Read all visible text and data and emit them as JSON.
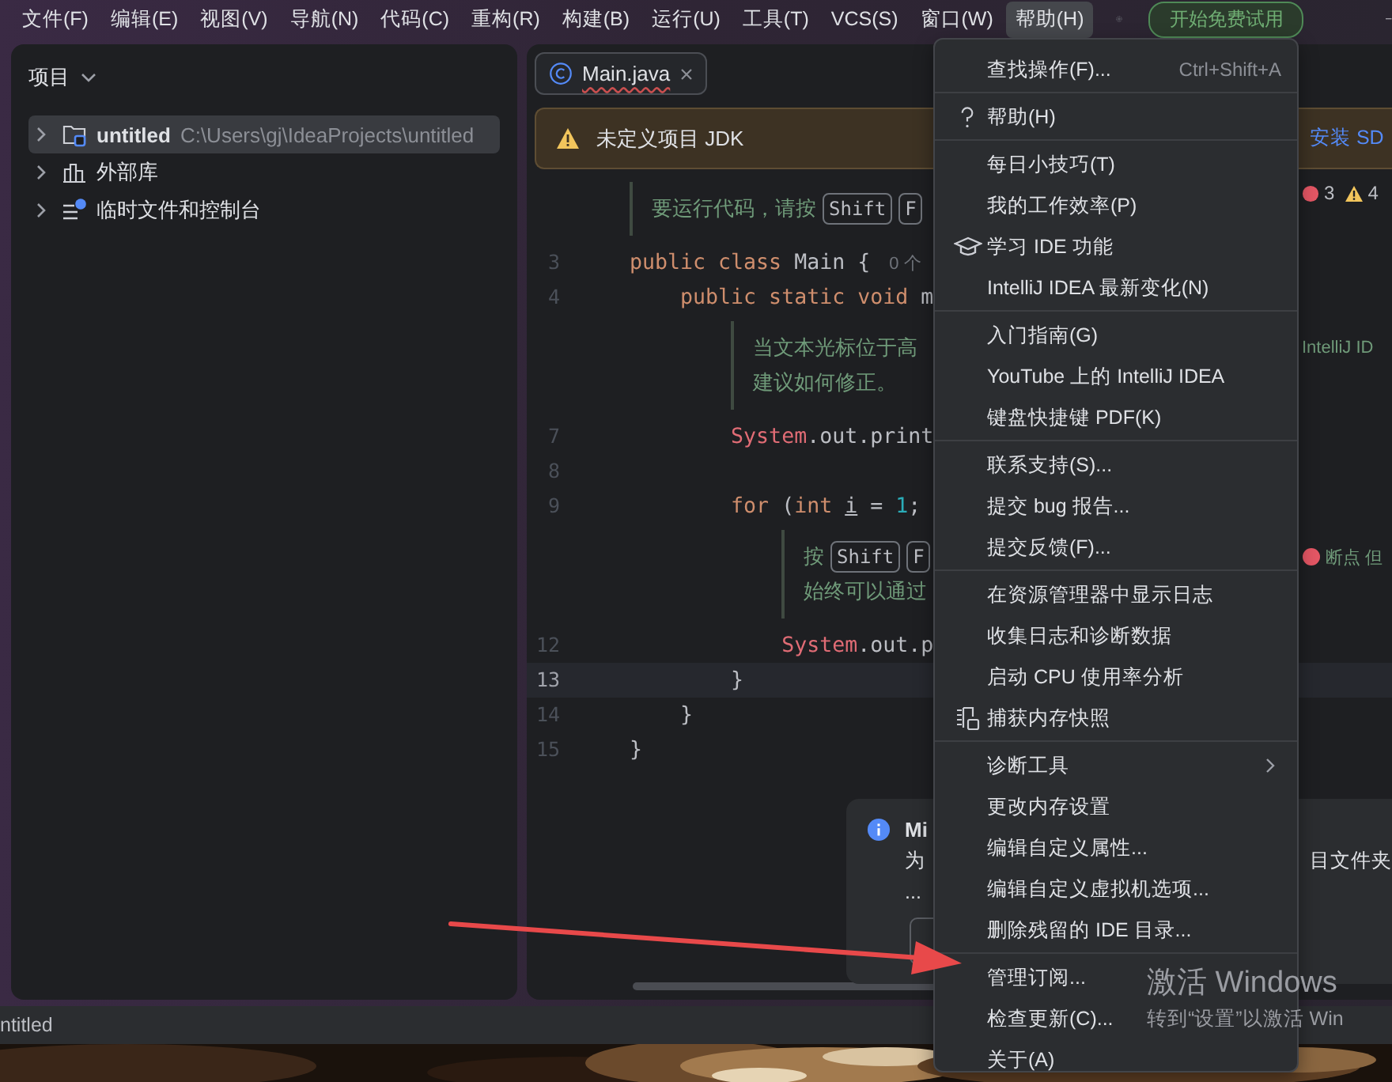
{
  "menu_bar": {
    "items": [
      {
        "label": "文件(F)",
        "selected": false
      },
      {
        "label": "编辑(E)",
        "selected": false
      },
      {
        "label": "视图(V)",
        "selected": false
      },
      {
        "label": "导航(N)",
        "selected": false
      },
      {
        "label": "代码(C)",
        "selected": false
      },
      {
        "label": "重构(R)",
        "selected": false
      },
      {
        "label": "构建(B)",
        "selected": false
      },
      {
        "label": "运行(U)",
        "selected": false
      },
      {
        "label": "工具(T)",
        "selected": false
      },
      {
        "label": "VCS(S)",
        "selected": false
      },
      {
        "label": "窗口(W)",
        "selected": false
      },
      {
        "label": "帮助(H)",
        "selected": true
      }
    ],
    "trial_button": "开始免费试用"
  },
  "project_panel": {
    "title": "项目",
    "tree": [
      {
        "kind": "module",
        "label": "untitled",
        "path": "C:\\Users\\gj\\IdeaProjects\\untitled",
        "selected": true,
        "expanded": false
      },
      {
        "kind": "library",
        "label": "外部库",
        "selected": false,
        "expanded": false
      },
      {
        "kind": "scratch",
        "label": "临时文件和控制台",
        "selected": false,
        "expanded": false
      }
    ]
  },
  "editor": {
    "tabs": [
      {
        "label": "Main.java",
        "selected": true
      }
    ],
    "banner": {
      "text": "未定义项目 JDK",
      "action": "安装 SD"
    },
    "rows": [
      {
        "kind": "hint",
        "lines": [
          {
            "parts": [
              {
                "t": "要运行代码，请按"
              },
              {
                "key": "Shift"
              },
              {
                "key": "F"
              }
            ],
            "side": {
              "kind": "problems",
              "errors": "3",
              "warnings": "4"
            }
          }
        ]
      },
      {
        "kind": "code",
        "number": "3",
        "current": false,
        "tokens": [
          {
            "t": "public class ",
            "kind": "keyword"
          },
          {
            "t": "Main {",
            "kind": "plain"
          }
        ],
        "inlay": "0 个"
      },
      {
        "kind": "code",
        "number": "4",
        "current": false,
        "tokens": [
          {
            "t": "    public static void ",
            "kind": "keyword"
          },
          {
            "t": "m",
            "kind": "plain"
          }
        ]
      },
      {
        "kind": "hint",
        "lines": [
          {
            "parts": [
              {
                "t": "当文本光标位于高"
              }
            ],
            "side": {
              "kind": "text",
              "text": "IntelliJ ID"
            }
          },
          {
            "parts": [
              {
                "t": "建议如何修正。"
              }
            ]
          }
        ]
      },
      {
        "kind": "code",
        "number": "7",
        "current": false,
        "tokens": [
          {
            "t": "        System",
            "kind": "class"
          },
          {
            "t": ".out.print",
            "kind": "plain"
          }
        ]
      },
      {
        "kind": "code",
        "number": "8",
        "current": false
      },
      {
        "kind": "code",
        "number": "9",
        "current": false,
        "tokens": [
          {
            "t": "        for",
            "kind": "keyword"
          },
          {
            "t": " (",
            "kind": "plain"
          },
          {
            "t": "int ",
            "kind": "keyword"
          },
          {
            "t": "i",
            "kind": "variable"
          },
          {
            "t": " = ",
            "kind": "plain"
          },
          {
            "t": "1",
            "kind": "number"
          },
          {
            "t": ";",
            "kind": "plain"
          }
        ]
      },
      {
        "kind": "hint",
        "lines": [
          {
            "parts": [
              {
                "t": "按"
              },
              {
                "key": "Shift"
              },
              {
                "key": "F"
              }
            ],
            "side": {
              "kind": "breakpoint",
              "text": "断点 但"
            }
          },
          {
            "parts": [
              {
                "t": "始终可以通过"
              }
            ]
          }
        ]
      },
      {
        "kind": "code",
        "number": "12",
        "current": false,
        "tokens": [
          {
            "t": "            System",
            "kind": "class"
          },
          {
            "t": ".out.p",
            "kind": "plain"
          }
        ]
      },
      {
        "kind": "code",
        "number": "13",
        "current": true,
        "tokens": [
          {
            "t": "        }",
            "kind": "plain"
          }
        ]
      },
      {
        "kind": "code",
        "number": "14",
        "current": false,
        "tokens": [
          {
            "t": "    }",
            "kind": "plain"
          }
        ]
      },
      {
        "kind": "code",
        "number": "15",
        "current": false,
        "tokens": [
          {
            "t": "}",
            "kind": "plain"
          }
        ]
      }
    ]
  },
  "notification": {
    "title": "Mi",
    "body": "为",
    "more": "...",
    "side_text": "目文件夹"
  },
  "help_menu": {
    "groups": [
      [
        {
          "kind": "plain",
          "label": "查找操作(F)...",
          "shortcut": "Ctrl+Shift+A"
        }
      ],
      [
        {
          "kind": "help",
          "label": "帮助(H)"
        }
      ],
      [
        {
          "kind": "plain",
          "label": "每日小技巧(T)"
        },
        {
          "kind": "plain",
          "label": "我的工作效率(P)"
        },
        {
          "kind": "learn",
          "label": "学习 IDE 功能"
        },
        {
          "kind": "plain",
          "label": "IntelliJ IDEA 最新变化(N)"
        }
      ],
      [
        {
          "kind": "plain",
          "label": "入门指南(G)"
        },
        {
          "kind": "plain",
          "label": "YouTube 上的 IntelliJ IDEA"
        },
        {
          "kind": "plain",
          "label": "键盘快捷键 PDF(K)"
        }
      ],
      [
        {
          "kind": "plain",
          "label": "联系支持(S)..."
        },
        {
          "kind": "plain",
          "label": "提交 bug 报告..."
        },
        {
          "kind": "plain",
          "label": "提交反馈(F)..."
        }
      ],
      [
        {
          "kind": "plain",
          "label": "在资源管理器中显示日志"
        },
        {
          "kind": "plain",
          "label": "收集日志和诊断数据"
        },
        {
          "kind": "plain",
          "label": "启动 CPU 使用率分析"
        },
        {
          "kind": "snapshot",
          "label": "捕获内存快照"
        }
      ],
      [
        {
          "kind": "submenu",
          "label": "诊断工具"
        },
        {
          "kind": "plain",
          "label": "更改内存设置"
        },
        {
          "kind": "plain",
          "label": "编辑自定义属性..."
        },
        {
          "kind": "plain",
          "label": "编辑自定义虚拟机选项..."
        },
        {
          "kind": "plain",
          "label": "删除残留的 IDE 目录..."
        }
      ],
      [
        {
          "kind": "plain",
          "label": "管理订阅..."
        },
        {
          "kind": "plain",
          "label": "检查更新(C)..."
        },
        {
          "kind": "plain",
          "label": "关于(A)"
        }
      ]
    ]
  },
  "status_bar": {
    "path": "ntitled"
  },
  "os_watermark": {
    "title": "激活 Windows",
    "subtitle": "转到“设置”以激活 Win"
  }
}
